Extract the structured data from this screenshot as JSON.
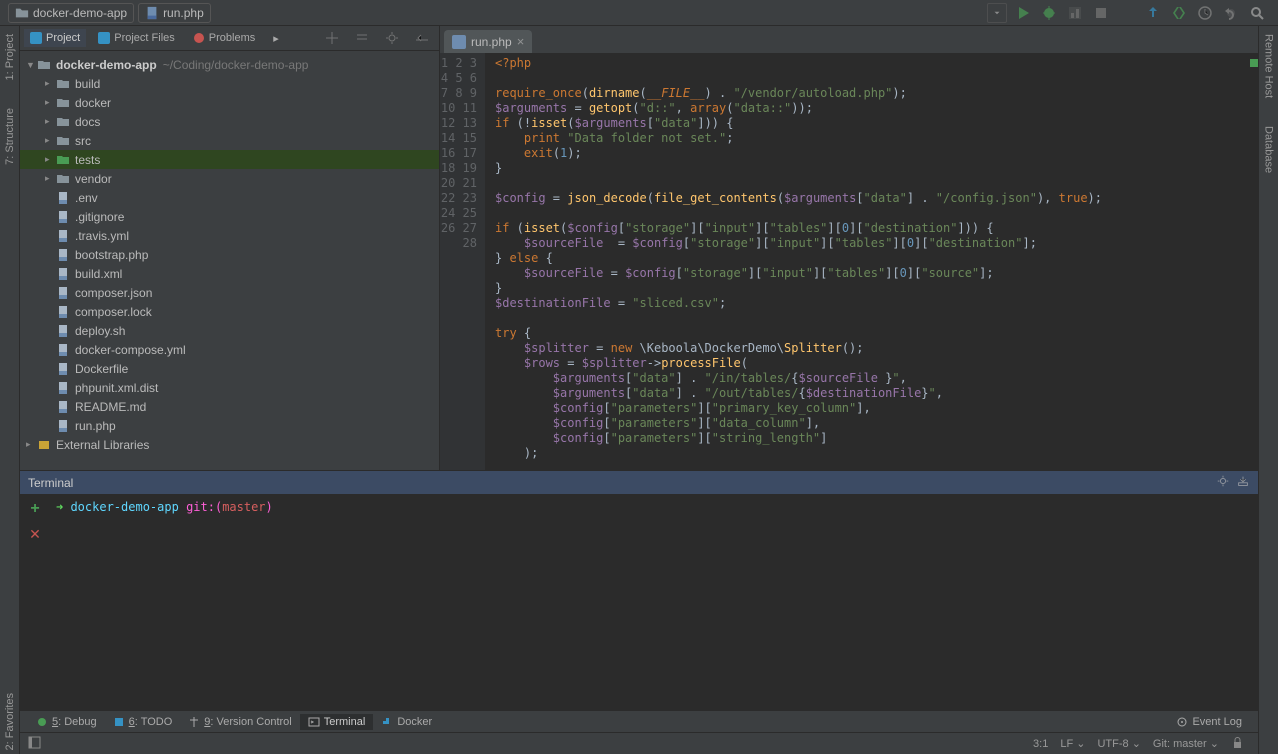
{
  "breadcrumb": {
    "project": "docker-demo-app",
    "file": "run.php"
  },
  "project_panel": {
    "tabs": [
      "Project",
      "Project Files",
      "Problems"
    ],
    "root_name": "docker-demo-app",
    "root_path": "~/Coding/docker-demo-app",
    "folders": [
      {
        "name": "build",
        "kind": "dir"
      },
      {
        "name": "docker",
        "kind": "dir"
      },
      {
        "name": "docs",
        "kind": "dir"
      },
      {
        "name": "src",
        "kind": "dir"
      },
      {
        "name": "tests",
        "kind": "test",
        "selected": true
      },
      {
        "name": "vendor",
        "kind": "dir"
      }
    ],
    "files": [
      ".env",
      ".gitignore",
      ".travis.yml",
      "bootstrap.php",
      "build.xml",
      "composer.json",
      "composer.lock",
      "deploy.sh",
      "docker-compose.yml",
      "Dockerfile",
      "phpunit.xml.dist",
      "README.md",
      "run.php"
    ],
    "external_libs": "External Libraries"
  },
  "editor": {
    "tab_label": "run.php",
    "lines": [
      "1",
      "2",
      "3",
      "4",
      "5",
      "6",
      "7",
      "8",
      "9",
      "10",
      "11",
      "12",
      "13",
      "14",
      "15",
      "16",
      "17",
      "18",
      "19",
      "20",
      "21",
      "22",
      "23",
      "24",
      "25",
      "26",
      "27",
      "28"
    ]
  },
  "left_tools": {
    "project": "1: Project",
    "structure": "7: Structure",
    "favorites": "2: Favorites"
  },
  "right_tools": {
    "remote": "Remote Host",
    "database": "Database"
  },
  "terminal": {
    "title": "Terminal",
    "prompt_dir": "docker-demo-app",
    "prompt_git": "git:(",
    "prompt_branch": "master",
    "prompt_close": ")"
  },
  "bottom_tabs": {
    "debug": "5: Debug",
    "todo": "6: TODO",
    "vcs": "9: Version Control",
    "terminal": "Terminal",
    "docker": "Docker",
    "event_log": "Event Log"
  },
  "status": {
    "pos": "3:1",
    "le": "LF",
    "enc": "UTF-8",
    "git": "Git: master"
  }
}
